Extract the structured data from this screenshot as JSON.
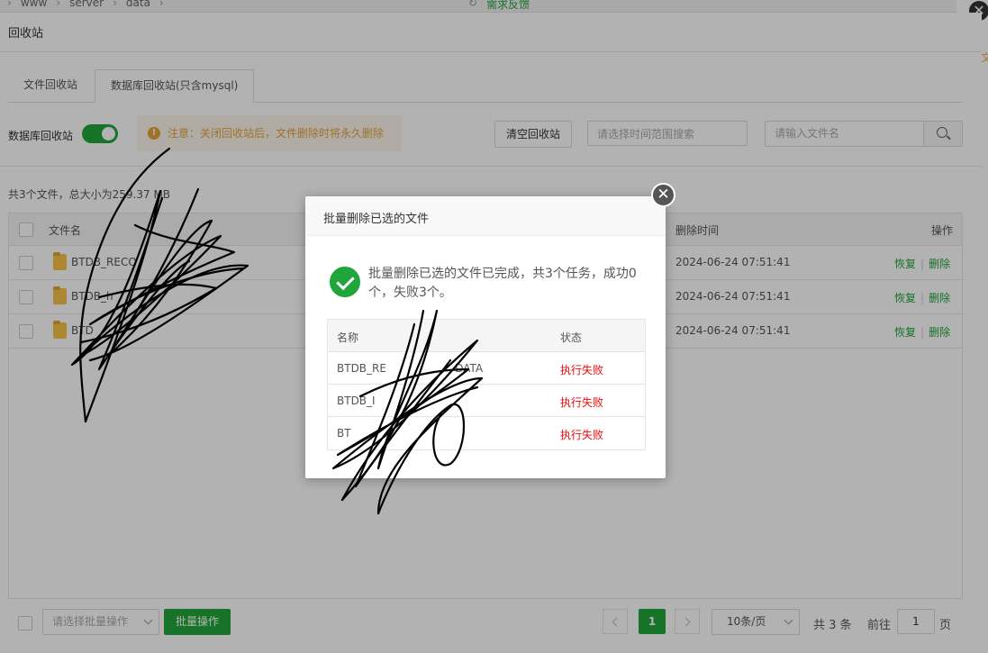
{
  "topbar": {
    "crumbs": [
      "www",
      "server",
      "data"
    ],
    "refresh_icon": "refresh-icon",
    "feedback_label": "需求反馈"
  },
  "dialog": {
    "title": "回收站",
    "tabs": [
      {
        "label": "文件回收站",
        "active": false
      },
      {
        "label": "数据库回收站(只含mysql)",
        "active": true
      }
    ],
    "toggle_label": "数据库回收站",
    "toggle_on": true,
    "warning": "注意：关闭回收站后，文件删除时将永久删除",
    "clear_button": "清空回收站",
    "time_placeholder": "请选择时间范围搜索",
    "name_placeholder": "请输入文件名",
    "summary": "共3个文件，总大小为259.37 MB",
    "columns": {
      "name": "文件名",
      "time": "删除时间",
      "ops": "操作"
    },
    "rows": [
      {
        "name": "BTDB_RECO",
        "time": "2024-06-24 07:51:41",
        "recover": "恢复",
        "delete": "删除"
      },
      {
        "name": "BTDB_h",
        "time": "2024-06-24 07:51:41",
        "recover": "恢复",
        "delete": "删除"
      },
      {
        "name": "BTD",
        "time": "2024-06-24 07:51:41",
        "recover": "恢复",
        "delete": "删除"
      }
    ]
  },
  "footer": {
    "batch_placeholder": "请选择批量操作",
    "batch_button": "批量操作",
    "current_page": "1",
    "page_size": "10条/页",
    "total": "共 3 条",
    "goto_label": "前往",
    "goto_value": "1",
    "page_label": "页"
  },
  "modal": {
    "title": "批量删除已选的文件",
    "message": "批量删除已选的文件已完成，共3个任务，成功0个，失败3个。",
    "columns": {
      "name": "名称",
      "status": "状态"
    },
    "rows": [
      {
        "name": "BTDB_RE                    DATA",
        "status": "执行失败"
      },
      {
        "name": "BTDB_I",
        "status": "执行失败"
      },
      {
        "name": "BT",
        "status": "执行失败"
      }
    ]
  },
  "colors": {
    "accent": "#20a53a",
    "warning": "#e6a23c",
    "fail": "#ef0808"
  }
}
